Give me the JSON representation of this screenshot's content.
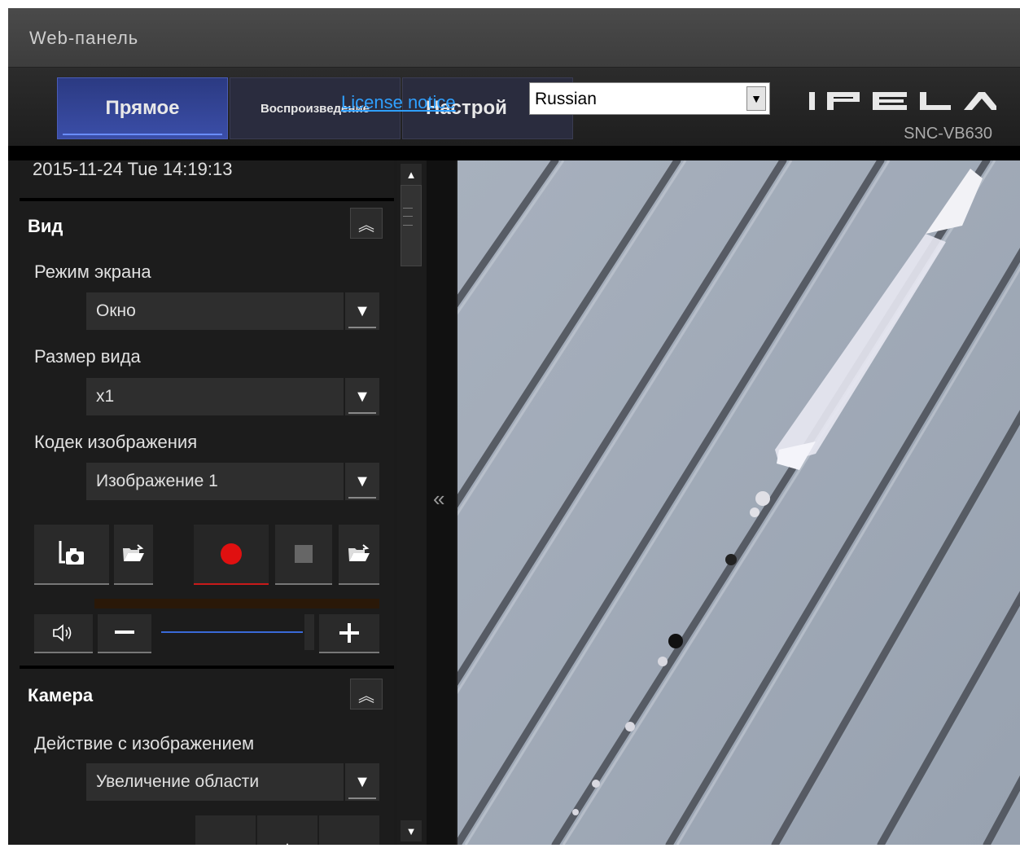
{
  "window": {
    "title": "Web-панель"
  },
  "header": {
    "tabs": [
      {
        "label": "Прямое",
        "active": true
      },
      {
        "label": "Воспроизведение",
        "active": false
      },
      {
        "label": "Настрой",
        "active": false
      }
    ],
    "license_link": "License notice",
    "language": {
      "selected": "Russian"
    },
    "brand": "IPELA",
    "model": "SNC-VB630"
  },
  "status": {
    "datetime": "2015-11-24 Tue 14:19:13"
  },
  "view_section": {
    "title": "Вид",
    "screen_mode": {
      "label": "Режим экрана",
      "value": "Окно"
    },
    "view_size": {
      "label": "Размер вида",
      "value": "x1"
    },
    "image_codec": {
      "label": "Кодек изображения",
      "value": "Изображение 1"
    }
  },
  "camera_section": {
    "title": "Камера",
    "image_action": {
      "label": "Действие с изображением",
      "value": "Увеличение области"
    }
  },
  "icons": {
    "collapse": "double-chevron-up-icon",
    "snapshot": "camera-icon",
    "folder": "folder-icon",
    "record": "record-icon",
    "stop": "stop-icon",
    "speaker": "speaker-icon",
    "minus": "minus-icon",
    "plus": "plus-icon"
  },
  "colors": {
    "active_tab": "#3b4ea8",
    "record": "#e01010",
    "link": "#2fa0ff",
    "slider": "#3a6ad8"
  }
}
